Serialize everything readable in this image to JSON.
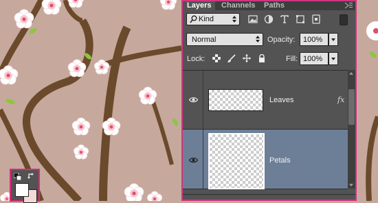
{
  "panel": {
    "tabs": [
      {
        "label": "Layers",
        "active": true
      },
      {
        "label": "Channels",
        "active": false
      },
      {
        "label": "Paths",
        "active": false
      }
    ],
    "filter": {
      "kind": "Kind",
      "icons": [
        "image-filter-icon",
        "adjustment-filter-icon",
        "type-filter-icon",
        "shape-filter-icon",
        "smart-object-filter-icon"
      ]
    },
    "blend_mode": "Normal",
    "opacity_label": "Opacity:",
    "opacity_value": "100%",
    "lock_label": "Lock:",
    "lock_icons": [
      "lock-transparent-pixels-icon",
      "lock-image-pixels-icon",
      "lock-position-icon",
      "lock-all-icon"
    ],
    "fill_label": "Fill:",
    "fill_value": "100%",
    "layers": [
      {
        "name": "Leaves",
        "visible": true,
        "selected": false,
        "has_fx": true,
        "fx_label": "fx"
      },
      {
        "name": "Petals",
        "visible": true,
        "selected": true,
        "has_fx": false
      }
    ]
  },
  "colors": {
    "canvas_bg": "#c6a89d",
    "branch": "#6b4a2c",
    "petal": "#ffffff",
    "petal_center": "#e04f6b",
    "leaf": "#8cc63f",
    "panel_bg": "#535353",
    "selected_row": "#6d7f97",
    "highlight_border": "#d0357e",
    "foreground_swatch": "#ffffff",
    "background_swatch": "#f1dad8"
  }
}
